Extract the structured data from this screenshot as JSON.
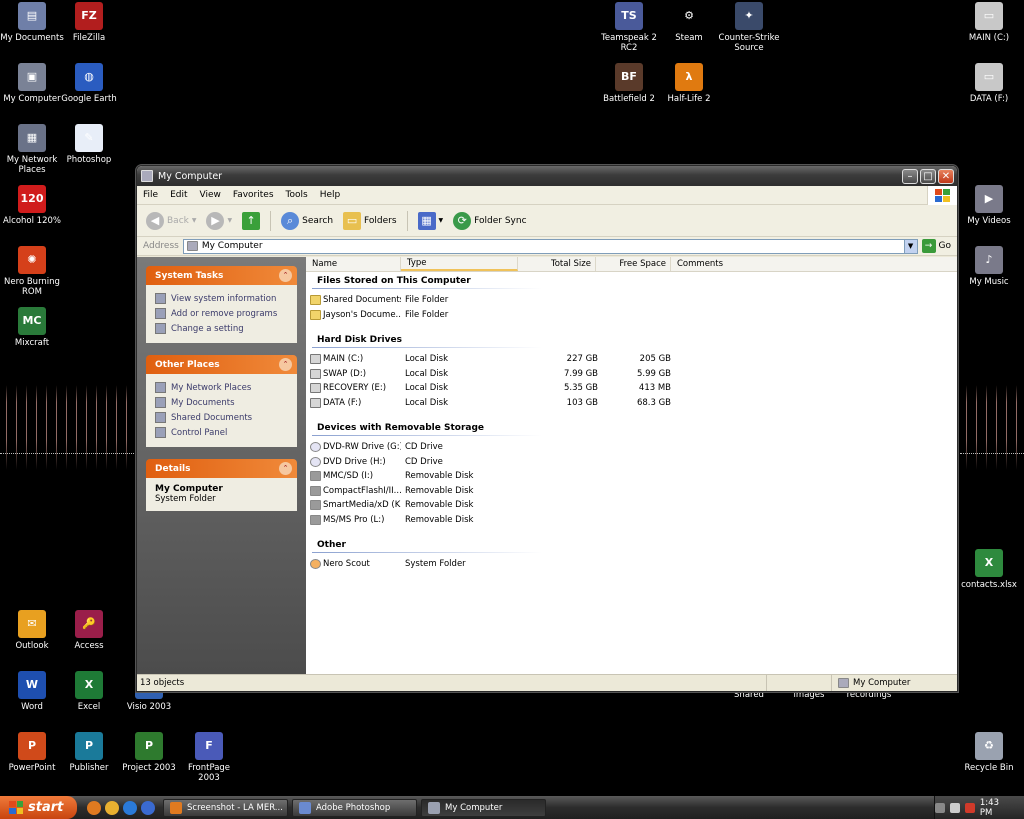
{
  "desktop": {
    "left_icons": [
      {
        "label": "My Documents",
        "color": "#6f7fa8",
        "glyph": "▤"
      },
      {
        "label": "FileZilla",
        "color": "#b21e1e",
        "glyph": "FZ"
      },
      {
        "label": "My Computer",
        "color": "#7a8296",
        "glyph": "▣"
      },
      {
        "label": "Google Earth",
        "color": "#2a5cc0",
        "glyph": "◍"
      },
      {
        "label": "My Network Places",
        "color": "#6a7288",
        "glyph": "▦"
      },
      {
        "label": "Photoshop",
        "color": "#e8eef8",
        "glyph": "✎"
      },
      {
        "label": "Alcohol 120%",
        "color": "#d01c1c",
        "glyph": "120"
      },
      {
        "label": "Nero Burning ROM",
        "color": "#d5401a",
        "glyph": "✺"
      },
      {
        "label": "Mixcraft",
        "color": "#2a7a3a",
        "glyph": "MC"
      },
      {
        "label": "Outlook",
        "color": "#e8a020",
        "glyph": "✉"
      },
      {
        "label": "Access",
        "color": "#9a1e4a",
        "glyph": "🔑"
      },
      {
        "label": "Word",
        "color": "#1e4fb0",
        "glyph": "W"
      },
      {
        "label": "Excel",
        "color": "#1e7a36",
        "glyph": "X"
      },
      {
        "label": "Visio 2003",
        "color": "#3060b0",
        "glyph": "V"
      },
      {
        "label": "PowerPoint",
        "color": "#d04a1a",
        "glyph": "P"
      },
      {
        "label": "Publisher",
        "color": "#1a7a9a",
        "glyph": "P"
      },
      {
        "label": "Project 2003",
        "color": "#2e7a2e",
        "glyph": "P"
      },
      {
        "label": "FrontPage 2003",
        "color": "#4a5ab8",
        "glyph": "F"
      }
    ],
    "top_icons": [
      {
        "label": "Teamspeak 2 RC2",
        "color": "#4a5a9a",
        "glyph": "TS"
      },
      {
        "label": "Steam",
        "color": "#000000",
        "glyph": "⚙"
      },
      {
        "label": "Counter-Strike Source",
        "color": "#3a4a6a",
        "glyph": "✦"
      },
      {
        "label": "Battlefield 2",
        "color": "#5a3a2a",
        "glyph": "BF"
      },
      {
        "label": "Half-Life 2",
        "color": "#e07a10",
        "glyph": "λ"
      }
    ],
    "right_icons": [
      {
        "label": "MAIN (C:)",
        "color": "#c8c8c8",
        "glyph": "▭"
      },
      {
        "label": "DATA (F:)",
        "color": "#c8c8c8",
        "glyph": "▭"
      },
      {
        "label": "My Videos",
        "color": "#7a7a8a",
        "glyph": "▶"
      },
      {
        "label": "My Music",
        "color": "#7a7a8a",
        "glyph": "♪"
      },
      {
        "label": "contacts.xlsx",
        "color": "#2e8a3e",
        "glyph": "X"
      },
      {
        "label": "Recycle Bin",
        "color": "#9aa2b0",
        "glyph": "♻"
      }
    ],
    "bottom_icons": [
      {
        "label": "Shared",
        "color": "#f1d46a",
        "glyph": ""
      },
      {
        "label": "images",
        "color": "#f1d46a",
        "glyph": ""
      },
      {
        "label": "recordings",
        "color": "#f1d46a",
        "glyph": ""
      }
    ]
  },
  "window": {
    "title": "My Computer",
    "menu": [
      "File",
      "Edit",
      "View",
      "Favorites",
      "Tools",
      "Help"
    ],
    "toolbar": {
      "back": "Back",
      "search": "Search",
      "folders": "Folders",
      "folder_sync": "Folder Sync"
    },
    "address": {
      "label": "Address",
      "value": "My Computer",
      "go": "Go"
    },
    "task_pane": {
      "system_tasks": {
        "title": "System Tasks",
        "items": [
          "View system information",
          "Add or remove programs",
          "Change a setting"
        ]
      },
      "other_places": {
        "title": "Other Places",
        "items": [
          "My Network Places",
          "My Documents",
          "Shared Documents",
          "Control Panel"
        ]
      },
      "details": {
        "title": "Details",
        "name": "My Computer",
        "kind": "System Folder"
      }
    },
    "columns": [
      "Name",
      "Type",
      "Total Size",
      "Free Space",
      "Comments"
    ],
    "groups": [
      {
        "title": "Files Stored on This Computer",
        "rows": [
          {
            "name": "Shared Documents",
            "type": "File Folder",
            "total": "",
            "free": "",
            "icon": "folder"
          },
          {
            "name": "Jayson's Docume...",
            "type": "File Folder",
            "total": "",
            "free": "",
            "icon": "folder"
          }
        ]
      },
      {
        "title": "Hard Disk Drives",
        "rows": [
          {
            "name": "MAIN (C:)",
            "type": "Local Disk",
            "total": "227 GB",
            "free": "205 GB",
            "icon": "disk"
          },
          {
            "name": "SWAP (D:)",
            "type": "Local Disk",
            "total": "7.99 GB",
            "free": "5.99 GB",
            "icon": "disk"
          },
          {
            "name": "RECOVERY (E:)",
            "type": "Local Disk",
            "total": "5.35 GB",
            "free": "413 MB",
            "icon": "disk"
          },
          {
            "name": "DATA (F:)",
            "type": "Local Disk",
            "total": "103 GB",
            "free": "68.3 GB",
            "icon": "disk"
          }
        ]
      },
      {
        "title": "Devices with Removable Storage",
        "rows": [
          {
            "name": "DVD-RW Drive (G:)",
            "type": "CD Drive",
            "total": "",
            "free": "",
            "icon": "cd"
          },
          {
            "name": "DVD Drive (H:)",
            "type": "CD Drive",
            "total": "",
            "free": "",
            "icon": "cd"
          },
          {
            "name": "MMC/SD (I:)",
            "type": "Removable Disk",
            "total": "",
            "free": "",
            "icon": "rem"
          },
          {
            "name": "CompactFlashI/II...",
            "type": "Removable Disk",
            "total": "",
            "free": "",
            "icon": "rem"
          },
          {
            "name": "SmartMedia/xD (K:)",
            "type": "Removable Disk",
            "total": "",
            "free": "",
            "icon": "rem"
          },
          {
            "name": "MS/MS Pro (L:)",
            "type": "Removable Disk",
            "total": "",
            "free": "",
            "icon": "rem"
          }
        ]
      },
      {
        "title": "Other",
        "rows": [
          {
            "name": "Nero Scout",
            "type": "System Folder",
            "total": "",
            "free": "",
            "icon": "nero"
          }
        ]
      }
    ],
    "status": {
      "count": "13 objects",
      "location": "My Computer"
    }
  },
  "taskbar": {
    "start": "start",
    "tasks": [
      {
        "label": "Screenshot - LA MER...",
        "color": "#e07a20",
        "active": false
      },
      {
        "label": "Adobe Photoshop",
        "color": "#6a8ad0",
        "active": false
      },
      {
        "label": "My Computer",
        "color": "#9aa0b0",
        "active": true
      }
    ],
    "clock": "1:43 PM"
  }
}
